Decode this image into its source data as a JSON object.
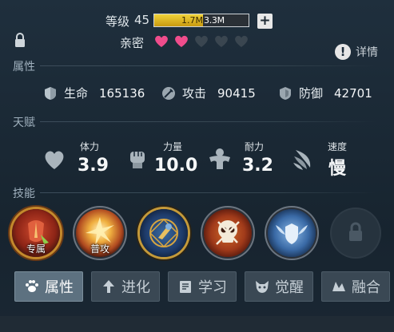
{
  "header": {
    "level_label": "等级",
    "level": "45",
    "exp_current": "1.7M",
    "exp_max": "3.3M",
    "exp_progress": 0.52,
    "intimacy_label": "亲密",
    "hearts_filled": 2,
    "hearts_total": 5,
    "detail_label": "详情"
  },
  "sections": {
    "attributes": "属性",
    "talent": "天赋",
    "skills": "技能"
  },
  "stats": [
    {
      "label": "生命",
      "value": "165136",
      "icon": "shield-hp-icon"
    },
    {
      "label": "攻击",
      "value": "90415",
      "icon": "sword-icon"
    },
    {
      "label": "防御",
      "value": "42701",
      "icon": "armor-icon"
    }
  ],
  "talents": [
    {
      "label": "体力",
      "value": "3.9",
      "icon": "heart-icon"
    },
    {
      "label": "力量",
      "value": "10.0",
      "icon": "fist-icon"
    },
    {
      "label": "耐力",
      "value": "3.2",
      "icon": "muscle-icon"
    },
    {
      "label": "速度",
      "value": "慢",
      "icon": "wing-icon"
    }
  ],
  "skills": [
    {
      "tag": "专属",
      "icon": "exclusive-skill-icon"
    },
    {
      "tag": "普攻",
      "icon": "normal-attack-icon"
    },
    {
      "tag": "",
      "icon": "magic-circle-skill-icon"
    },
    {
      "tag": "",
      "icon": "skull-skill-icon"
    },
    {
      "tag": "",
      "icon": "winged-shield-skill-icon"
    },
    {
      "tag": "",
      "icon": "locked-skill-icon"
    }
  ],
  "tabs": [
    {
      "label": "属性",
      "icon": "paw-icon",
      "active": true
    },
    {
      "label": "进化",
      "icon": "arrow-up-icon",
      "active": false
    },
    {
      "label": "学习",
      "icon": "book-icon",
      "active": false
    },
    {
      "label": "觉醒",
      "icon": "beast-icon",
      "active": false
    },
    {
      "label": "融合",
      "icon": "fusion-icon",
      "active": false
    }
  ],
  "colors": {
    "background": "#1b2a38",
    "exp_fill": "#e6c02a",
    "heart_filled": "#f04d8c",
    "heart_empty": "#3a4650",
    "active_tab": "#5d7180"
  }
}
